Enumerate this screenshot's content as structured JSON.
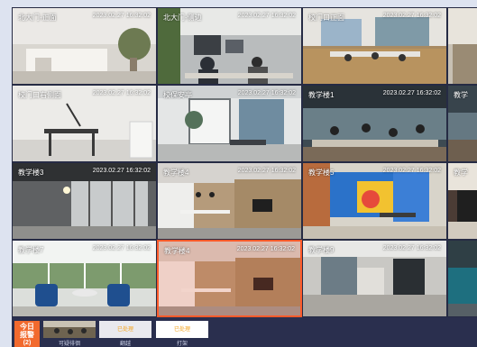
{
  "tiles": [
    {
      "label": "北大门-正面",
      "time": "2023.02.27 16:32:02"
    },
    {
      "label": "北大门-侧边",
      "time": "2023.02.27 16:32:02"
    },
    {
      "label": "校门口正面",
      "time": "2023.02.27 16:32:02"
    },
    {
      "label": "",
      "time": ""
    },
    {
      "label": "校门口右侧面",
      "time": "2023.02.27 16:32:02"
    },
    {
      "label": "校保安亭",
      "time": "2023.02.27 16:32:02"
    },
    {
      "label": "教学楼1",
      "time": "2023.02.27 16:32:02"
    },
    {
      "label": "教学",
      "time": ""
    },
    {
      "label": "教学楼3",
      "time": "2023.02.27 16:32:02"
    },
    {
      "label": "教学楼4",
      "time": "2023.02.27 16:32:02"
    },
    {
      "label": "教学楼5",
      "time": "2023.02.27 16:32:02"
    },
    {
      "label": "教学",
      "time": ""
    },
    {
      "label": "教学楼7",
      "time": "2023.02.27 16:32:02"
    },
    {
      "label": "教学楼4",
      "time": "2023.02.27 16:32:02"
    },
    {
      "label": "教学楼9",
      "time": "2023.02.27 16:32:02"
    },
    {
      "label": "",
      "time": ""
    }
  ],
  "selected_tile": "教学楼4",
  "alarms": {
    "badge_line1": "今日",
    "badge_line2": "报警",
    "badge_count": "(2)",
    "items": [
      {
        "caption": "可疑徘徊",
        "status": ""
      },
      {
        "caption": "翻越",
        "status": "已处理"
      },
      {
        "caption": "打架",
        "status": "已处理"
      }
    ]
  },
  "colors": {
    "accent": "#ff5a2a",
    "badge": "#f26a2e",
    "background": "#1b2038"
  }
}
